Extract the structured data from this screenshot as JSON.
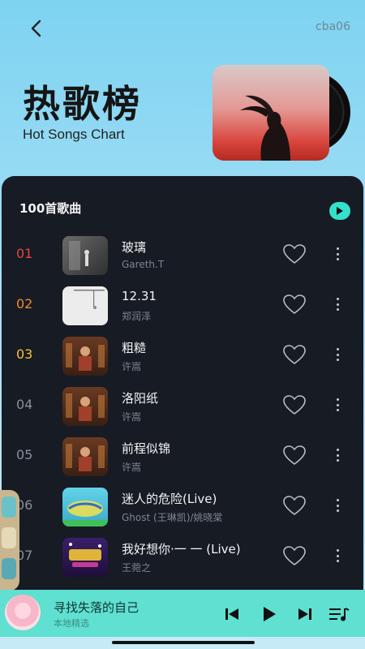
{
  "header": {
    "back_icon": "chevron-left-icon",
    "user_id": "cba06",
    "title": "热歌榜",
    "subtitle": "Hot Songs Chart"
  },
  "panel": {
    "count_label": "100首歌曲",
    "play_all_icon": "play-icon"
  },
  "songs": [
    {
      "rank": "01",
      "title": "玻璃",
      "artist": "Gareth.T",
      "rank_color": "#e8453c"
    },
    {
      "rank": "02",
      "title": "12.31",
      "artist": "郑润泽",
      "rank_color": "#f08a2c"
    },
    {
      "rank": "03",
      "title": "粗糙",
      "artist": "许嵩",
      "rank_color": "#f3c03a"
    },
    {
      "rank": "04",
      "title": "洛阳纸",
      "artist": "许嵩",
      "rank_color": "#8a8f98"
    },
    {
      "rank": "05",
      "title": "前程似锦",
      "artist": "许嵩",
      "rank_color": "#8a8f98"
    },
    {
      "rank": "06",
      "title": "迷人的危险(Live)",
      "artist": "Ghost (王琳凯)/姚晓棠",
      "rank_color": "#8a8f98"
    },
    {
      "rank": "07",
      "title": "我好想你·一 一 (Live)",
      "artist": "王菀之",
      "rank_color": "#8a8f98"
    }
  ],
  "player": {
    "title": "寻找失落的自己",
    "subtitle": "本地精选",
    "prev_icon": "skip-previous-icon",
    "play_icon": "play-icon",
    "next_icon": "skip-next-icon",
    "playlist_icon": "playlist-icon"
  },
  "colors": {
    "accent": "#34e0c9",
    "panel_bg": "#161b24",
    "player_bg": "#5fe0d0"
  }
}
